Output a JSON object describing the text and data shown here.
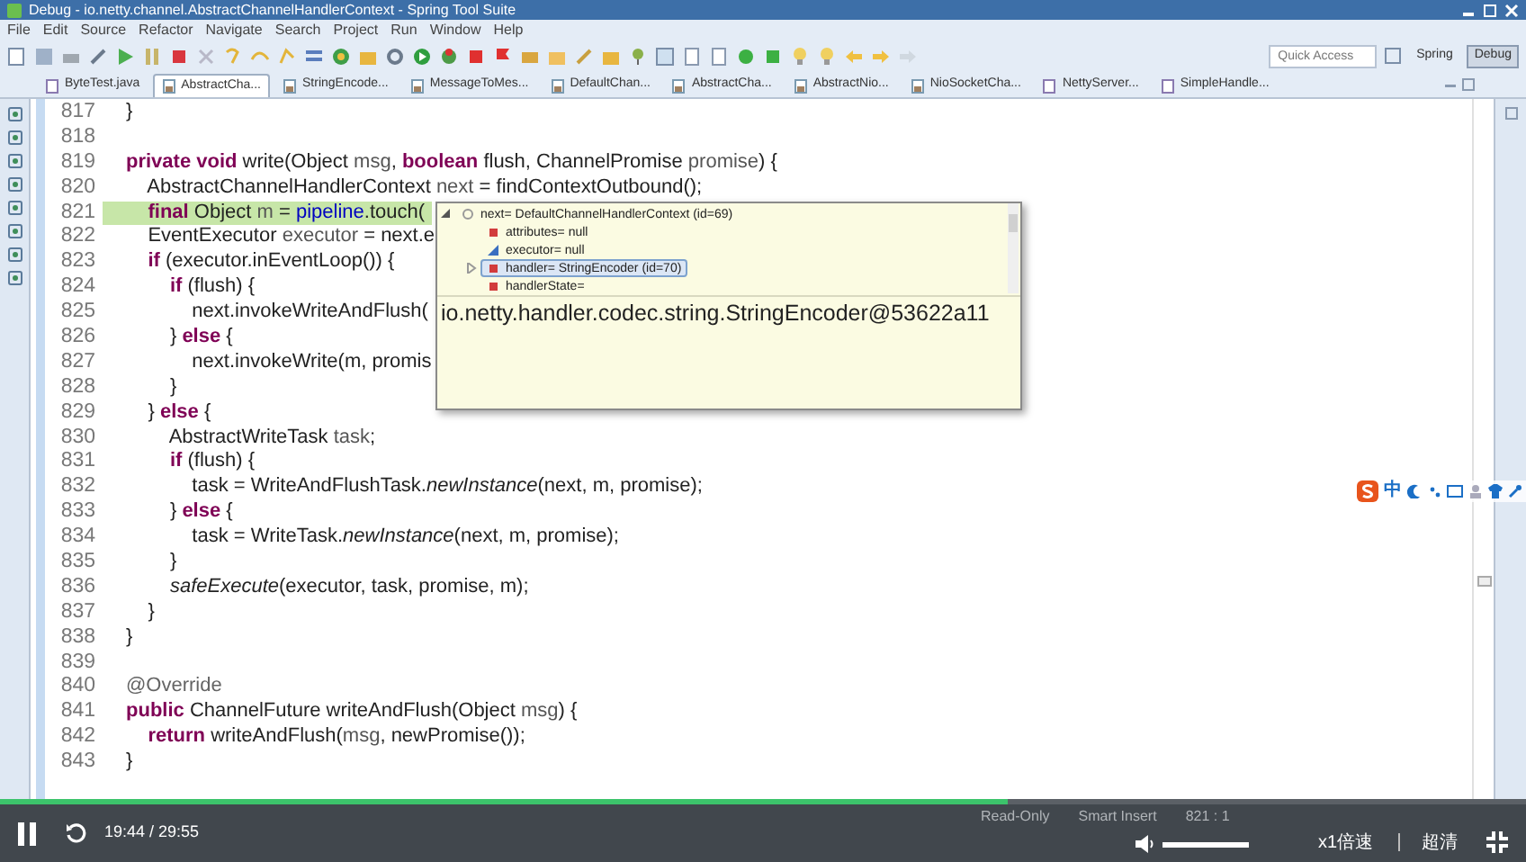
{
  "window": {
    "title": "Debug - io.netty.channel.AbstractChannelHandlerContext - Spring Tool Suite"
  },
  "menu": [
    "File",
    "Edit",
    "Source",
    "Refactor",
    "Navigate",
    "Search",
    "Project",
    "Run",
    "Window",
    "Help"
  ],
  "toolbar": {
    "quick_access": {
      "placeholder": "Quick Access"
    },
    "perspectives": [
      {
        "label": "Spring",
        "selected": false
      },
      {
        "label": "Debug",
        "selected": true
      }
    ]
  },
  "editor_tabs": [
    {
      "label": "ByteTest.java",
      "selected": false,
      "kind": "source"
    },
    {
      "label": "AbstractCha...",
      "selected": true,
      "kind": "class"
    },
    {
      "label": "StringEncode...",
      "selected": false,
      "kind": "class"
    },
    {
      "label": "MessageToMes...",
      "selected": false,
      "kind": "class"
    },
    {
      "label": "DefaultChan...",
      "selected": false,
      "kind": "class"
    },
    {
      "label": "AbstractCha...",
      "selected": false,
      "kind": "class"
    },
    {
      "label": "AbstractNio...",
      "selected": false,
      "kind": "class"
    },
    {
      "label": "NioSocketCha...",
      "selected": false,
      "kind": "class"
    },
    {
      "label": "NettyServer...",
      "selected": false,
      "kind": "source"
    },
    {
      "label": "SimpleHandle...",
      "selected": false,
      "kind": "source"
    }
  ],
  "code_lines": [
    {
      "number": "817",
      "current": false,
      "segments": [
        {
          "text": "}",
          "kind": "plain"
        }
      ]
    },
    {
      "number": "818",
      "current": false
    },
    {
      "number": "819",
      "current": false,
      "segments": [
        {
          "text": "private void ",
          "kind": "keyword"
        },
        {
          "text": "write(Object ",
          "kind": "plain"
        },
        {
          "text": "msg",
          "kind": "var"
        },
        {
          "text": ", ",
          "kind": "plain"
        },
        {
          "text": "boolean ",
          "kind": "keyword"
        },
        {
          "text": "flush, ChannelPromise ",
          "kind": "plain"
        },
        {
          "text": "promise",
          "kind": "var"
        },
        {
          "text": ") {",
          "kind": "plain"
        }
      ]
    },
    {
      "number": "820",
      "current": false,
      "segments": [
        {
          "text": "    AbstractChannelHandlerContext ",
          "kind": "plain"
        },
        {
          "text": "next",
          "kind": "var"
        },
        {
          "text": " = findContextOutbound();",
          "kind": "plain"
        }
      ]
    },
    {
      "number": "821",
      "current": true,
      "segments": [
        {
          "text": "    final ",
          "kind": "keyword"
        },
        {
          "text": "Object ",
          "kind": "plain"
        },
        {
          "text": "m",
          "kind": "var"
        },
        {
          "text": " = ",
          "kind": "plain"
        },
        {
          "text": "pipeline",
          "kind": "field"
        },
        {
          "text": ".touch(",
          "kind": "plain"
        }
      ]
    },
    {
      "number": "822",
      "current": false,
      "segments": [
        {
          "text": "    EventExecutor ",
          "kind": "plain"
        },
        {
          "text": "executor",
          "kind": "var"
        },
        {
          "text": " = next.e",
          "kind": "plain"
        }
      ]
    },
    {
      "number": "823",
      "current": false,
      "segments": [
        {
          "text": "    if ",
          "kind": "keyword"
        },
        {
          "text": "(executor.inEventLoop()) {",
          "kind": "plain"
        }
      ]
    },
    {
      "number": "824",
      "current": false,
      "segments": [
        {
          "text": "        if ",
          "kind": "keyword"
        },
        {
          "text": "(flush) {",
          "kind": "plain"
        }
      ]
    },
    {
      "number": "825",
      "current": false,
      "segments": [
        {
          "text": "            next.invokeWriteAndFlush(",
          "kind": "plain"
        }
      ]
    },
    {
      "number": "826",
      "current": false,
      "segments": [
        {
          "text": "        } ",
          "kind": "plain"
        },
        {
          "text": "else ",
          "kind": "keyword"
        },
        {
          "text": "{",
          "kind": "plain"
        }
      ]
    },
    {
      "number": "827",
      "current": false,
      "segments": [
        {
          "text": "            next.invokeWrite(m, promis",
          "kind": "plain"
        }
      ]
    },
    {
      "number": "828",
      "current": false,
      "segments": [
        {
          "text": "        }",
          "kind": "plain"
        }
      ]
    },
    {
      "number": "829",
      "current": false,
      "segments": [
        {
          "text": "    } ",
          "kind": "plain"
        },
        {
          "text": "else ",
          "kind": "keyword"
        },
        {
          "text": "{",
          "kind": "plain"
        }
      ]
    },
    {
      "number": "830",
      "current": false,
      "segments": [
        {
          "text": "        AbstractWriteTask ",
          "kind": "plain"
        },
        {
          "text": "task",
          "kind": "var"
        },
        {
          "text": ";",
          "kind": "plain"
        }
      ]
    },
    {
      "number": "831",
      "current": false,
      "segments": [
        {
          "text": "        if ",
          "kind": "keyword"
        },
        {
          "text": "(flush) {",
          "kind": "plain"
        }
      ]
    },
    {
      "number": "832",
      "current": false,
      "segments": [
        {
          "text": "            task = WriteAndFlushTask.",
          "kind": "plain"
        },
        {
          "text": "newInstance",
          "kind": "static"
        },
        {
          "text": "(next, m, promise);",
          "kind": "plain"
        }
      ]
    },
    {
      "number": "833",
      "current": false,
      "segments": [
        {
          "text": "        } ",
          "kind": "plain"
        },
        {
          "text": "else ",
          "kind": "keyword"
        },
        {
          "text": "{",
          "kind": "plain"
        }
      ]
    },
    {
      "number": "834",
      "current": false,
      "segments": [
        {
          "text": "            task = WriteTask.",
          "kind": "plain"
        },
        {
          "text": "newInstance",
          "kind": "static"
        },
        {
          "text": "(next, m, promise);",
          "kind": "plain"
        }
      ]
    },
    {
      "number": "835",
      "current": false,
      "segments": [
        {
          "text": "        }",
          "kind": "plain"
        }
      ]
    },
    {
      "number": "836",
      "current": false,
      "segments": [
        {
          "text": "        safeExecute",
          "kind": "static"
        },
        {
          "text": "(executor, task, promise, m);",
          "kind": "plain"
        }
      ]
    },
    {
      "number": "837",
      "current": false,
      "segments": [
        {
          "text": "    }",
          "kind": "plain"
        }
      ]
    },
    {
      "number": "838",
      "current": false,
      "segments": [
        {
          "text": "}",
          "kind": "plain"
        }
      ]
    },
    {
      "number": "839",
      "current": false
    },
    {
      "number": "840",
      "current": false,
      "segments": [
        {
          "text": "@Override",
          "kind": "annotation"
        }
      ]
    },
    {
      "number": "841",
      "current": false,
      "segments": [
        {
          "text": "public ",
          "kind": "keyword"
        },
        {
          "text": "ChannelFuture writeAndFlush(Object ",
          "kind": "plain"
        },
        {
          "text": "msg",
          "kind": "var"
        },
        {
          "text": ") {",
          "kind": "plain"
        }
      ]
    },
    {
      "number": "842",
      "current": false,
      "segments": [
        {
          "text": "    return ",
          "kind": "keyword"
        },
        {
          "text": "writeAndFlush(",
          "kind": "plain"
        },
        {
          "text": "msg",
          "kind": "var"
        },
        {
          "text": ", newPromise());",
          "kind": "plain"
        }
      ]
    },
    {
      "number": "843",
      "current": false,
      "segments": [
        {
          "text": "}",
          "kind": "plain"
        }
      ]
    }
  ],
  "hover_popup": {
    "tree": [
      {
        "label": "next= DefaultChannelHandlerContext  (id=69)",
        "kind": "local",
        "expanded": true,
        "selected": false,
        "children": [
          {
            "label": "attributes= null",
            "kind": "private",
            "selected": false
          },
          {
            "label": "executor= null",
            "kind": "final",
            "selected": false
          },
          {
            "label": "handler= StringEncoder  (id=70)",
            "kind": "private",
            "expanded": false,
            "selected": true
          },
          {
            "label": "handlerState=",
            "kind": "private",
            "selected": false
          }
        ]
      }
    ],
    "detail": "io.netty.handler.codec.string.StringEncoder@53622a11"
  },
  "ime_bar": {
    "mode": "中"
  },
  "status_bar": [
    "Read-Only",
    "Smart Insert",
    "821 : 1"
  ],
  "player": {
    "progress": {
      "level": 0.66
    },
    "time": "19:44 / 29:55",
    "playing": true,
    "volume": {
      "level": 1
    },
    "speed": "x1倍速",
    "quality": "超清"
  }
}
